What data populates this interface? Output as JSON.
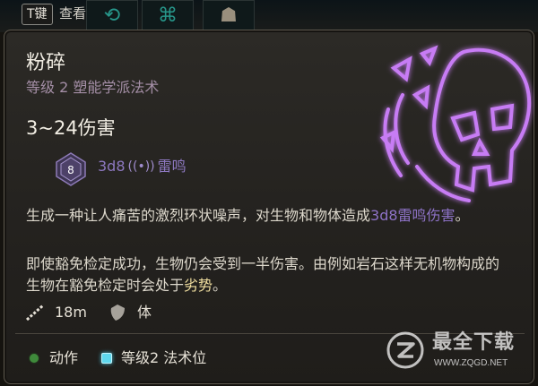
{
  "hint_bar": {
    "key": "T键",
    "action": "查看"
  },
  "spell": {
    "name": "粉碎",
    "subtitle": "等级 2 塑能学派法术",
    "damage": "3~24伤害",
    "die_face": "8",
    "dice": "3d8",
    "damage_type": "雷鸣",
    "description_1a": "生成一种让人痛苦的激烈环状噪声，对生物和物体造成",
    "description_1_link": "3d8雷鸣伤害",
    "description_1b": "。",
    "description_2a": "即使豁免检定成功，生物仍会受到一半伤害。由例如岩石这样无机物构成的生物在豁免检定时会处于",
    "description_2_keyword": "劣势",
    "description_2b": "。",
    "range": "18m",
    "save_stat": "体",
    "cost_action": "动作",
    "cost_slot": "等级2 法术位"
  },
  "watermark": {
    "name": "最全下载",
    "url": "WWW.ZQGD.NET"
  },
  "colors": {
    "accent_purple": "#8d72c6",
    "keyword_gold": "#f1dfa0",
    "action_green": "#3f8a3b",
    "slot_cyan": "#5fd8ee"
  },
  "icons": {
    "slot_1": "teal-rune-icon",
    "slot_2": "teal-rune-icon",
    "slot_3": "mask-rune-icon",
    "emblem": "thunder-skull-icon",
    "die": "d8-die-icon",
    "thunder": "thunder-damage-icon",
    "range": "range-icon",
    "save": "shield-save-icon",
    "action": "action-dot-icon",
    "slot": "spell-slot-icon"
  }
}
